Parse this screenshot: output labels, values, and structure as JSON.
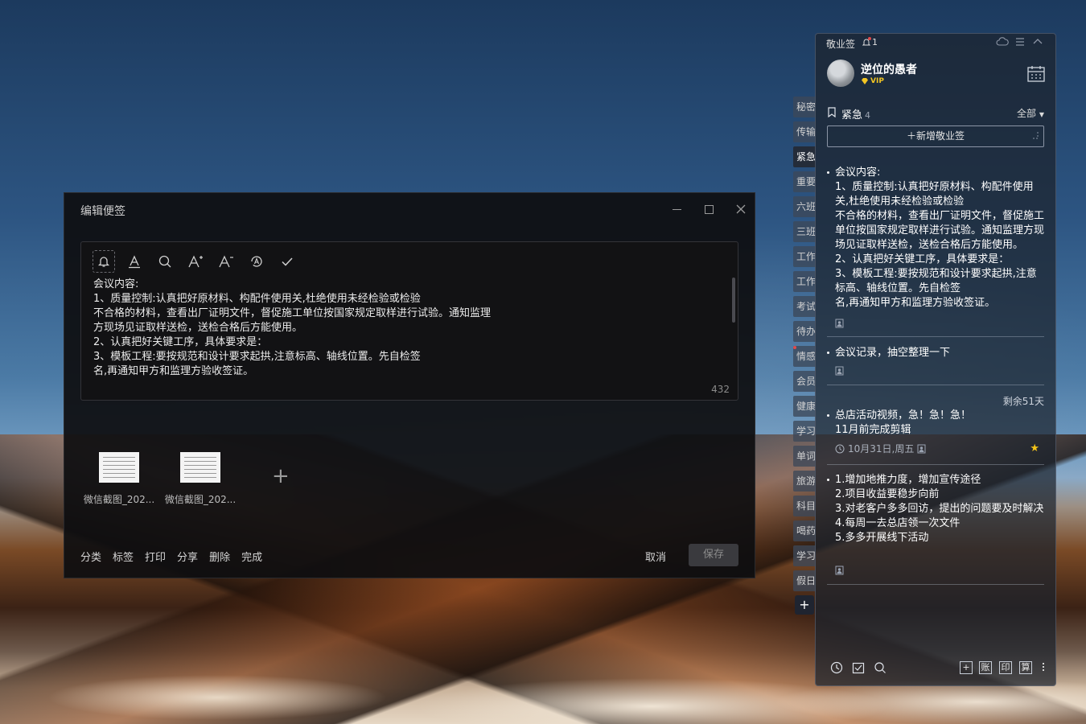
{
  "editor": {
    "title": "编辑便签",
    "content": "会议内容:\n1、质量控制:认真把好原材料、构配件使用关,杜绝使用未经检验或检验\n不合格的材料，查看出厂证明文件，督促施工单位按国家规定取样进行试验。通知监理\n方现场见证取样送检，送检合格后方能使用。\n2、认真把好关键工序，具体要求是：\n3、模板工程:要按规范和设计要求起拱,注意标高、轴线位置。先自检签\n名,再通知甲方和监理方验收签证。",
    "char_count": "432",
    "toolbar_icons": [
      "bell-icon",
      "text-color-icon",
      "search-icon",
      "font-increase-icon",
      "font-decrease-icon",
      "ocr-icon",
      "check-icon"
    ],
    "attachments": [
      {
        "name": "微信截图_202..."
      },
      {
        "name": "微信截图_202..."
      }
    ],
    "add_attachment": "+",
    "actions": {
      "classify": "分类",
      "tag": "标签",
      "print": "打印",
      "share": "分享",
      "delete": "删除",
      "done": "完成",
      "cancel": "取消",
      "save": "保存"
    }
  },
  "side_tabs": {
    "items": [
      "秘密",
      "传输",
      "紧急",
      "重要",
      "六班",
      "三班",
      "工作",
      "工作",
      "考试",
      "待办",
      "情感",
      "会员",
      "健康",
      "学习",
      "单词",
      "旅游",
      "科目",
      "喝药",
      "学习",
      "假日"
    ],
    "active_index": 2,
    "dot_index": 10,
    "add_label": "+"
  },
  "panel": {
    "app_name": "敬业签",
    "notification_count": "1",
    "user": {
      "name": "逆位的愚者",
      "badge": "VIP"
    },
    "category": {
      "name": "紧急",
      "count": "4",
      "filter": "全部"
    },
    "new_button": "＋新增敬业签",
    "notes": [
      {
        "text": "会议内容:\n1、质量控制:认真把好原材料、构配件使用关,杜绝使用未经检验或检验\n不合格的材料，查看出厂证明文件，督促施工单位按国家规定取样进行试验。通知监理方现场见证取样送检，送检合格后方能使用。\n2、认真把好关键工序，具体要求是：\n3、模板工程:要按规范和设计要求起拱,注意标高、轴线位置。先自检签\n名,再通知甲方和监理方验收签证。"
      },
      {
        "text": "会议记录，抽空整理一下"
      },
      {
        "remaining": "剩余51天",
        "text": "总店活动视频，急！急！急！\n11月前完成剪辑",
        "date": "10月31日,周五"
      },
      {
        "text": "1.增加地推力度，增加宣传途径\n2.项目收益要稳步向前\n3.对老客户多多回访，提出的问题要及时解决\n4.每周一去总店领一次文件\n5.多多开展线下活动"
      }
    ],
    "bottom": {
      "icons": [
        "clock-icon",
        "checklist-icon",
        "search-icon"
      ],
      "squares": [
        "+",
        "账",
        "印",
        "算"
      ]
    }
  }
}
